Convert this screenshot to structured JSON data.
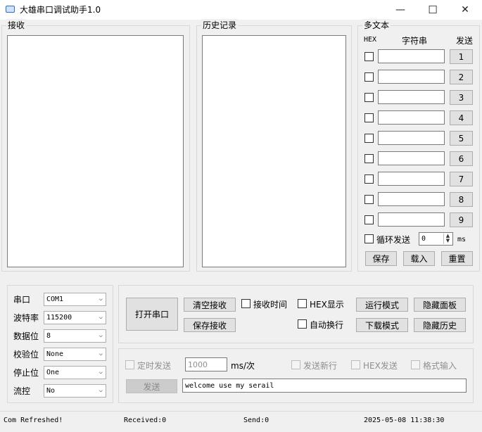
{
  "window": {
    "title": "大雄串口调试助手1.0",
    "min": "—",
    "max": "☐",
    "close": "✕"
  },
  "receive": {
    "label": "接收"
  },
  "history": {
    "label": "历史记录"
  },
  "multitext": {
    "label": "多文本",
    "col_hex": "HEX",
    "col_string": "字符串",
    "col_send": "发送",
    "rows": [
      {
        "button": "1",
        "value": ""
      },
      {
        "button": "2",
        "value": ""
      },
      {
        "button": "3",
        "value": ""
      },
      {
        "button": "4",
        "value": ""
      },
      {
        "button": "5",
        "value": ""
      },
      {
        "button": "6",
        "value": ""
      },
      {
        "button": "7",
        "value": ""
      },
      {
        "button": "8",
        "value": ""
      },
      {
        "button": "9",
        "value": ""
      }
    ],
    "loop_label": "循环发送",
    "loop_value": "0",
    "loop_unit": "ms",
    "save": "保存",
    "load": "载入",
    "reset": "重置"
  },
  "port_settings": {
    "rows": [
      {
        "label": "串口",
        "value": "COM1"
      },
      {
        "label": "波特率",
        "value": "115200"
      },
      {
        "label": "数据位",
        "value": "8"
      },
      {
        "label": "校验位",
        "value": "None"
      },
      {
        "label": "停止位",
        "value": "One"
      },
      {
        "label": "流控",
        "value": "No"
      }
    ]
  },
  "controls": {
    "open_port": "打开串口",
    "clear_receive": "清空接收",
    "save_receive": "保存接收",
    "receive_time": "接收时间",
    "hex_display": "HEX显示",
    "auto_newline": "自动换行",
    "run_mode": "运行模式",
    "download_mode": "下载模式",
    "hide_panel": "隐藏面板",
    "hide_history": "隐藏历史"
  },
  "send_area": {
    "timed_send": "定时发送",
    "interval": "1000",
    "interval_unit": "ms/次",
    "send_newline": "发送新行",
    "hex_send": "HEX发送",
    "format_input": "格式输入",
    "send_button": "发送",
    "send_text": "welcome use my serail"
  },
  "status": {
    "message": "Com Refreshed!",
    "received": "Received:0",
    "send": "Send:0",
    "datetime": "2025-05-08 11:38:30"
  }
}
